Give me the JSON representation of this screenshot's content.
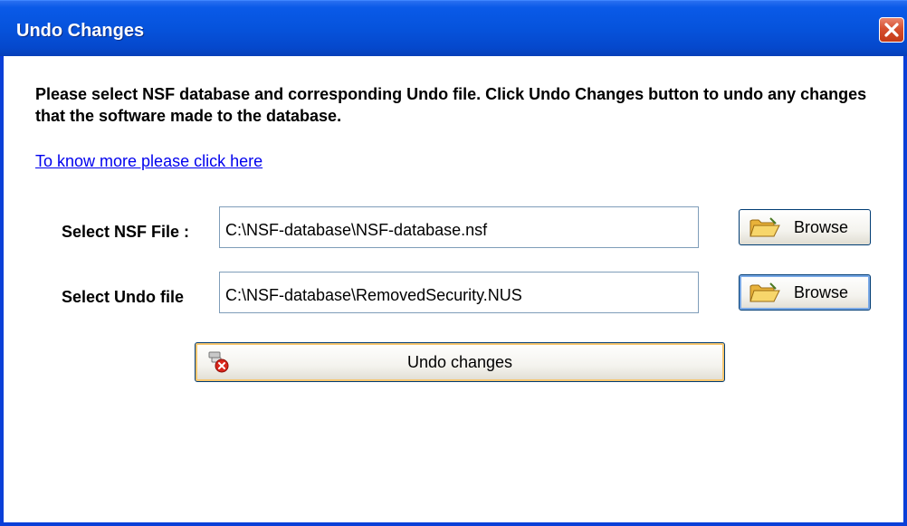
{
  "window": {
    "title": "Undo Changes",
    "close_icon": "close-icon",
    "colors": {
      "titlebar": "#0653dc",
      "close": "#d6502f"
    }
  },
  "main": {
    "description": "Please select NSF database and corresponding Undo file. Click Undo Changes button to undo any changes that the software made to the database.",
    "more_link": "To know more please click here",
    "nsf": {
      "label": "Select NSF File :",
      "value": "C:\\NSF-database\\NSF-database.nsf",
      "browse_label": "Browse",
      "browse_icon": "folder-open-icon"
    },
    "undo_file": {
      "label": "Select Undo file",
      "value": "C:\\NSF-database\\RemovedSecurity.NUS",
      "browse_label": "Browse",
      "browse_icon": "folder-open-icon"
    },
    "undo_button": {
      "label": "Undo changes",
      "icon": "undo-delete-icon"
    }
  }
}
